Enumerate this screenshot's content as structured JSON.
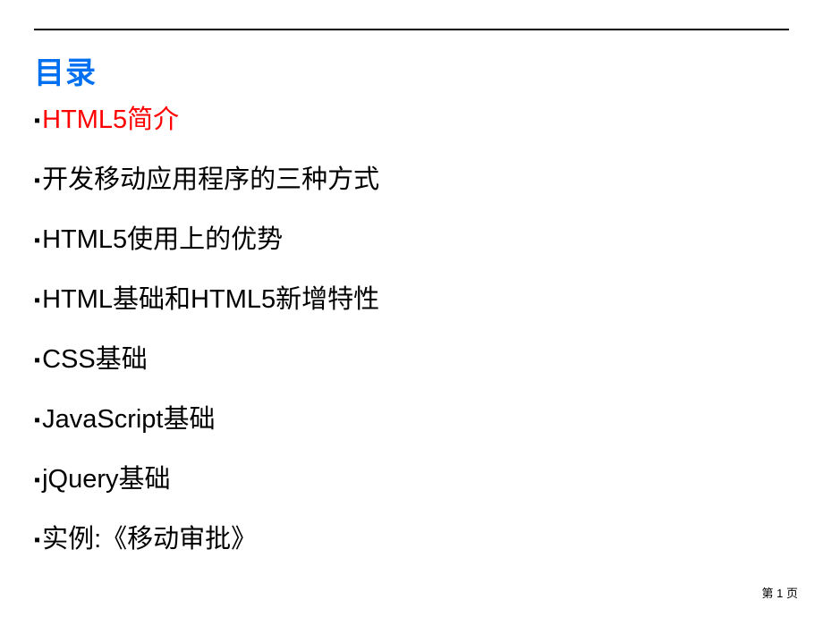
{
  "title": "目录",
  "toc": {
    "items": [
      {
        "label": "HTML5简介",
        "highlight": true
      },
      {
        "label": "开发移动应用程序的三种方式",
        "highlight": false
      },
      {
        "label": "HTML5使用上的优势",
        "highlight": false
      },
      {
        "label": "HTML基础和HTML5新增特性",
        "highlight": false
      },
      {
        "label": "CSS基础",
        "highlight": false
      },
      {
        "label": "JavaScript基础",
        "highlight": false
      },
      {
        "label": "jQuery基础",
        "highlight": false
      },
      {
        "label": "实例:《移动审批》",
        "highlight": false
      }
    ]
  },
  "footer": {
    "page_label": "第 1 页"
  },
  "bullet_char": "▪"
}
